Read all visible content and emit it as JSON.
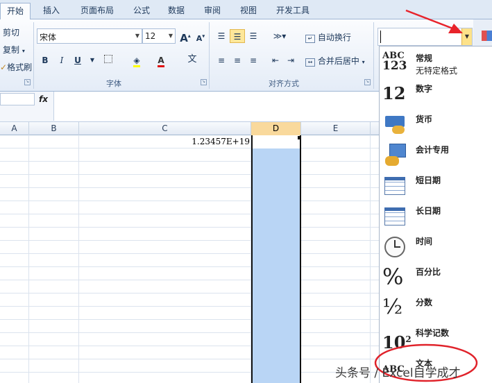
{
  "tabs": [
    "开始",
    "插入",
    "页面布局",
    "公式",
    "数据",
    "审阅",
    "视图",
    "开发工具"
  ],
  "clipboard": {
    "cut": "剪切",
    "copy": "复制",
    "format_painter": "格式刷"
  },
  "font": {
    "name": "宋体",
    "size": "12",
    "group_label": "字体",
    "bold": "B",
    "italic": "I",
    "underline": "U"
  },
  "alignment": {
    "wrap_text": "自动换行",
    "merge_center": "合并后居中",
    "group_label": "对齐方式"
  },
  "formula_bar": {
    "fx": "fx",
    "value": ""
  },
  "columns": [
    "A",
    "B",
    "C",
    "D",
    "E"
  ],
  "selected_column": "D",
  "cell_c1": "1.23457E+19",
  "number_format": {
    "current_value": "",
    "items": [
      {
        "label": "常规",
        "sub": "无特定格式",
        "icon": "general-icon",
        "glyph": "ABC 123"
      },
      {
        "label": "数字",
        "icon": "number-icon",
        "glyph": "12"
      },
      {
        "label": "货币",
        "icon": "currency-icon"
      },
      {
        "label": "会计专用",
        "icon": "accounting-icon"
      },
      {
        "label": "短日期",
        "icon": "short-date-icon"
      },
      {
        "label": "长日期",
        "icon": "long-date-icon"
      },
      {
        "label": "时间",
        "icon": "clock-icon"
      },
      {
        "label": "百分比",
        "icon": "percent-icon",
        "glyph": "%"
      },
      {
        "label": "分数",
        "icon": "fraction-icon",
        "glyph": "½"
      },
      {
        "label": "科学记数",
        "icon": "scientific-icon",
        "glyph": "10²"
      },
      {
        "label": "文本",
        "icon": "text-format-icon",
        "glyph": "ABC"
      }
    ]
  },
  "annotation": {
    "arrow_color": "#e8232b",
    "circle_color": "#e0222a"
  },
  "watermark": "头条号 / Excel自学成才"
}
